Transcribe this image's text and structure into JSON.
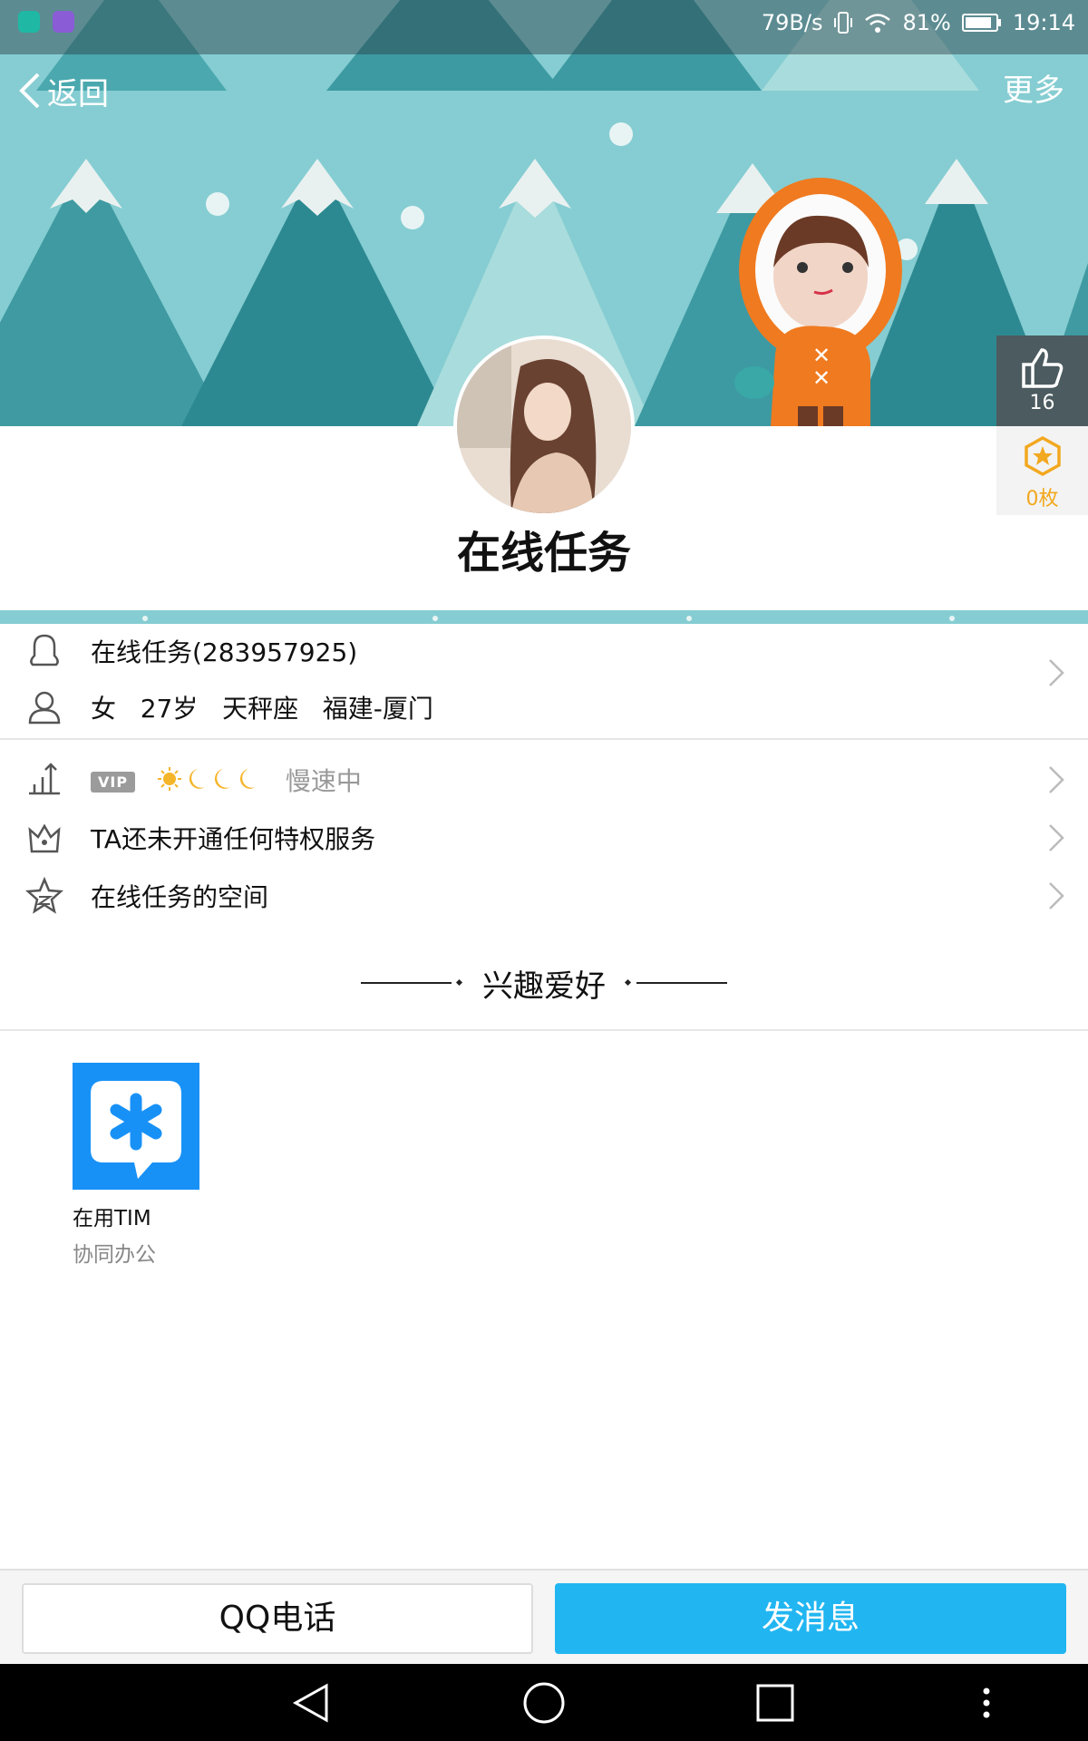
{
  "status_bar": {
    "net_speed": "79B/s",
    "battery_percent": "81%",
    "time": "19:14",
    "icons": [
      "moon-app-icon",
      "gallery-app-icon",
      "vibrate-icon",
      "wifi-icon",
      "battery-icon"
    ]
  },
  "navbar": {
    "back_label": "返回",
    "more_label": "更多"
  },
  "profile": {
    "display_name": "在线任务",
    "likes": "16",
    "badges": "0枚"
  },
  "info_rows": {
    "account": "在线任务(283957925)",
    "details": {
      "gender": "女",
      "age": "27岁",
      "zodiac": "天秤座",
      "location": "福建-厦门"
    },
    "level": {
      "vip_tag": "VIP",
      "level_icons": [
        "sun-icon",
        "moon-icon",
        "moon-icon",
        "moon-icon"
      ],
      "speed_status": "慢速中"
    },
    "privilege": "TA还未开通任何特权服务",
    "space": "在线任务的空间"
  },
  "interests": {
    "title": "兴趣爱好",
    "apps": [
      {
        "name": "在用TIM",
        "description": "协同办公"
      }
    ]
  },
  "actions": {
    "call_label": "QQ电话",
    "message_label": "发消息"
  },
  "colors": {
    "banner": "#85cdd2",
    "primary_button": "#21b6f1",
    "tim_blue": "#1891f7",
    "badge_gold": "#f2a81f"
  }
}
